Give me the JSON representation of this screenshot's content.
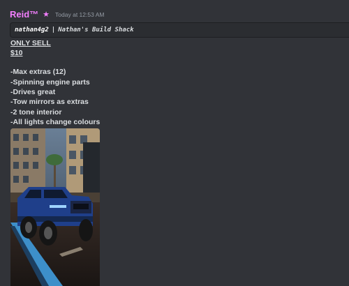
{
  "message": {
    "author": "Reid™",
    "timestamp": "Today at 12:53 AM",
    "code_block": {
      "name": "nathan4g2",
      "separator": "|",
      "shop": "Nathan's Build Shack"
    },
    "only_sell": "ONLY SELL",
    "price": "$10",
    "features": [
      "-Max extras (12)",
      "-Spinning engine parts",
      "-Drives great",
      "-Tow mirrors as extras",
      "-2 tone interior",
      "-All lights change colours"
    ]
  },
  "colors": {
    "background": "#313338",
    "author": "#f47fff",
    "timestamp": "#949ba4",
    "truck": "#1f3f8a"
  },
  "icons": {
    "role_badge": "star-icon"
  }
}
